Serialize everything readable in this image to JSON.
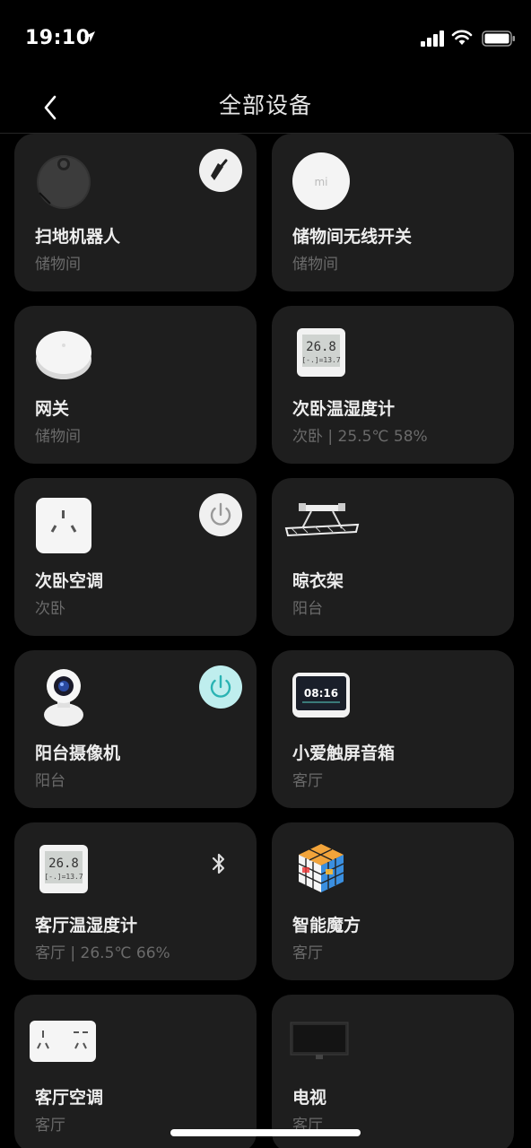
{
  "status_bar": {
    "time": "19:10"
  },
  "header": {
    "title": "全部设备"
  },
  "devices": [
    {
      "name": "扫地机器人",
      "room": "储物间",
      "icon": "robot-vacuum-icon",
      "action": "broom-icon"
    },
    {
      "name": "储物间无线开关",
      "room": "储物间",
      "icon": "wireless-switch-icon"
    },
    {
      "name": "网关",
      "room": "储物间",
      "icon": "gateway-icon"
    },
    {
      "name": "次卧温湿度计",
      "room": "次卧 | 25.5℃ 58%",
      "icon": "thermometer-display-icon",
      "display_top": "26.8",
      "display_bottom": "[-.]=13.7"
    },
    {
      "name": "次卧空调",
      "room": "次卧",
      "icon": "ac-socket-icon",
      "action": "power-icon",
      "action_state": "off"
    },
    {
      "name": "晾衣架",
      "room": "阳台",
      "icon": "clothes-rack-icon"
    },
    {
      "name": "阳台摄像机",
      "room": "阳台",
      "icon": "camera-icon",
      "action": "power-icon",
      "action_state": "on"
    },
    {
      "name": "小爱触屏音箱",
      "room": "客厅",
      "icon": "smart-display-icon",
      "display_time": "08:16"
    },
    {
      "name": "客厅温湿度计",
      "room": "客厅 | 26.5℃ 66%",
      "icon": "thermometer-display-icon",
      "display_top": "26.8",
      "display_bottom": "[-.]=13.7",
      "action": "bluetooth-icon"
    },
    {
      "name": "智能魔方",
      "room": "客厅",
      "icon": "magic-cube-icon"
    },
    {
      "name": "客厅空调",
      "room": "客厅",
      "icon": "ac-socket-icon"
    },
    {
      "name": "电视",
      "room": "客厅",
      "icon": "tv-icon"
    }
  ],
  "colors": {
    "background": "#000000",
    "card": "#1e1e1e",
    "secondary_text": "#6a6a6a",
    "power_on": "#2ab3b3"
  }
}
